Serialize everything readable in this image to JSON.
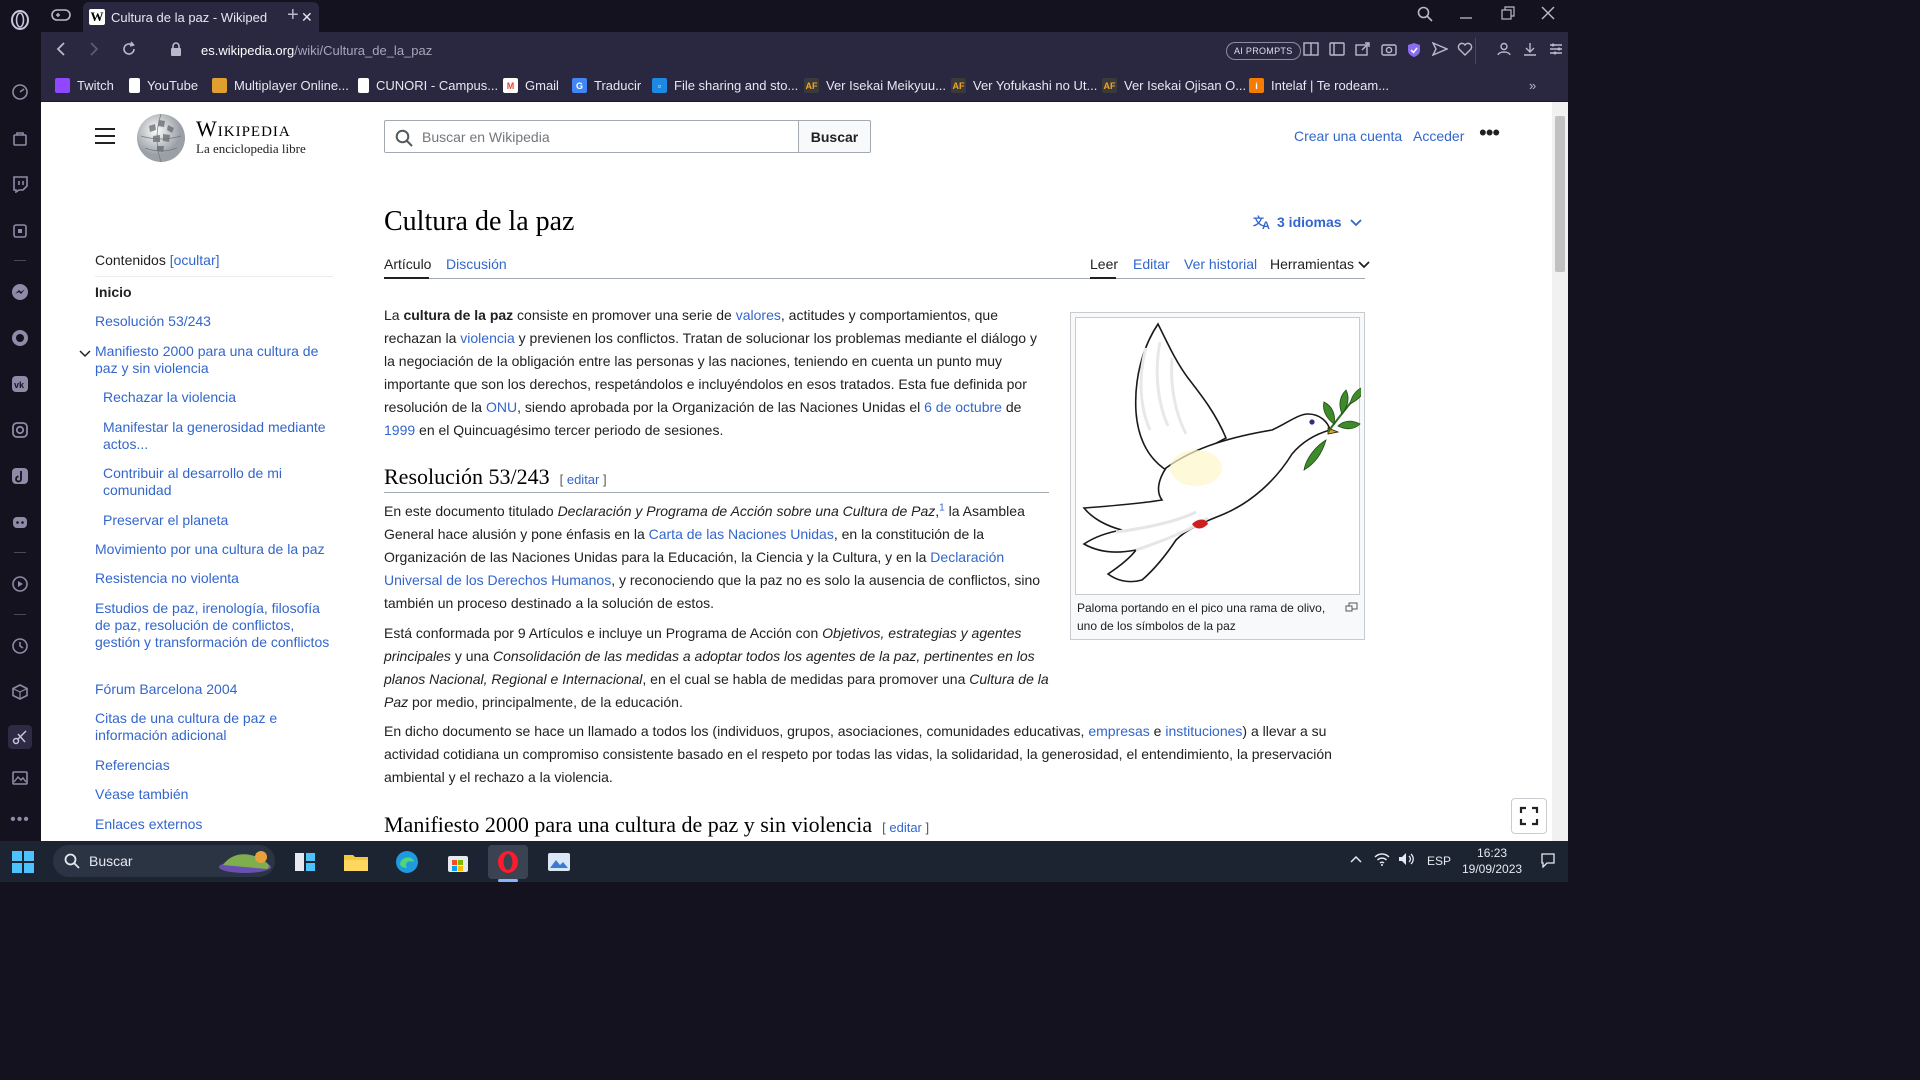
{
  "browser": {
    "tab": {
      "title": "Cultura de la paz - Wikiped",
      "favicon": "W"
    },
    "url": {
      "domain": "es.wikipedia.org",
      "path": "/wiki/Cultura_de_la_paz"
    },
    "ai_prompts_label": "AI PROMPTS",
    "bookmarks": [
      {
        "label": "Twitch",
        "icon": "twitch-icon",
        "color": "#9146ff"
      },
      {
        "label": "YouTube",
        "icon": "page-icon",
        "color": "#ffffff"
      },
      {
        "label": "Multiplayer Online...",
        "icon": "game-icon",
        "color": "#e0a030"
      },
      {
        "label": "CUNORI - Campus...",
        "icon": "page-icon",
        "color": "#ffffff"
      },
      {
        "label": "Gmail",
        "icon": "gmail-icon",
        "color": "#ea4335"
      },
      {
        "label": "Traducir",
        "icon": "translate-icon",
        "color": "#4285f4"
      },
      {
        "label": "File sharing and sto...",
        "icon": "dropbox-icon",
        "color": "#1e88e5"
      },
      {
        "label": "Ver Isekai Meikyuu...",
        "icon": "af-icon",
        "color": "#3a3a3a"
      },
      {
        "label": "Ver Yofukashi no Ut...",
        "icon": "af-icon",
        "color": "#3a3a3a"
      },
      {
        "label": "Ver Isekai Ojisan O...",
        "icon": "af-icon",
        "color": "#3a3a3a"
      },
      {
        "label": "Intelaf | Te rodeam...",
        "icon": "intelaf-icon",
        "color": "#f57c00"
      }
    ]
  },
  "wiki": {
    "wordmark": "Wikipedia",
    "tagline": "La enciclopedia libre",
    "search_placeholder": "Buscar en Wikipedia",
    "search_button": "Buscar",
    "create_account": "Crear una cuenta",
    "login": "Acceder",
    "toc": {
      "heading": "Contenidos",
      "toggle": "[ocultar]",
      "items": [
        "Inicio",
        "Resolución 53/243",
        "Manifiesto 2000 para una cultura de paz y sin violencia",
        "Rechazar la violencia",
        "Manifestar la generosidad mediante actos...",
        "Contribuir al desarrollo de mi comunidad",
        "Preservar el planeta",
        "Movimiento por una cultura de la paz",
        "Resistencia no violenta",
        "Estudios de paz, irenología, filosofía de paz, resolución de conflictos, gestión y transformación de conflictos",
        "Fórum Barcelona 2004",
        "Citas de una cultura de paz e información adicional",
        "Referencias",
        "Véase también",
        "Enlaces externos"
      ]
    },
    "title": "Cultura de la paz",
    "languages": "3 idiomas",
    "tabs": {
      "article": "Artículo",
      "discussion": "Discusión",
      "read": "Leer",
      "edit": "Editar",
      "history": "Ver historial",
      "tools": "Herramientas"
    },
    "intro": {
      "t1": "La ",
      "b1": "cultura de la paz",
      "t2": " consiste en promover una serie de ",
      "l1": "valores",
      "t3": ", actitudes y comportamientos, que rechazan la ",
      "l2": "violencia",
      "t4": " y previenen los conflictos. Tratan de solucionar los problemas mediante el diálogo y la negociación de la obligación entre las personas y las naciones, teniendo en cuenta un punto muy importante que son los derechos, respetándolos e incluyéndolos en esos tratados. Esta fue definida por resolución de la ",
      "l3": "ONU",
      "t5": ", siendo aprobada por la Organización de las Naciones Unidas el ",
      "l4": "6 de octubre",
      "t6": " de ",
      "l5": "1999",
      "t7": " en el Quincuagésimo tercer periodo de sesiones."
    },
    "section1": {
      "heading": "Resolución 53/243",
      "edit_open": "[ ",
      "edit": "editar",
      "edit_close": " ]",
      "p1": {
        "t1": "En este documento titulado ",
        "i1": "Declaración y Programa de Acción sobre una Cultura de Paz",
        "t2": ",",
        "ref": "1",
        "t3": " la Asamblea General hace alusión y pone énfasis en la ",
        "l1": "Carta de las Naciones Unidas",
        "t4": ", en la constitución de la Organización de las Naciones Unidas para la Educación, la Ciencia y la Cultura, y en la ",
        "l2": "Declaración Universal de los Derechos Humanos",
        "t5": ", y reconociendo que la paz no es solo la ausencia de conflictos, sino también un proceso destinado a la solución de estos."
      },
      "p2": {
        "t1": "Está conformada por 9 Artículos e incluye un Programa de Acción con ",
        "i1": "Objetivos, estrategias y agentes principales",
        "t2": " y una ",
        "i2": "Consolidación de las medidas a adoptar todos los agentes de la paz, pertinentes en los planos Nacional, Regional e Internacional",
        "t3": ", en el cual se habla de medidas para promover una ",
        "i3": "Cultura de la Paz",
        "t4": " por medio, principalmente, de la educación."
      },
      "p3": {
        "t1": "En dicho documento se hace un llamado a todos los (individuos, grupos, asociaciones, comunidades educativas, ",
        "l1": "empresas",
        "t2": " e ",
        "l2": "instituciones",
        "t3": ") a llevar a su actividad cotidiana un compromiso consistente basado en el respeto por todas las vidas, la solidaridad, la generosidad, el entendimiento, la preservación ambiental y el rechazo a la violencia."
      }
    },
    "section2": {
      "heading": "Manifiesto 2000 para una cultura de paz y sin violencia",
      "edit": "editar"
    },
    "figure_caption": "Paloma portando en el pico una rama de olivo, uno de los símbolos de la paz"
  },
  "taskbar": {
    "search": "Buscar",
    "lang": "ESP",
    "time": "16:23",
    "date": "19/09/2023"
  }
}
